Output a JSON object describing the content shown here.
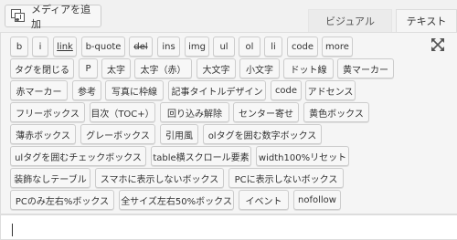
{
  "media_button": {
    "label": "メディアを追加",
    "icon": "media-icon"
  },
  "tabs": {
    "visual": "ビジュアル",
    "text": "テキスト"
  },
  "toolbar": {
    "fullscreen_icon": "fullscreen-icon",
    "rows": [
      [
        "b",
        "i",
        "link",
        "b-quote",
        "del",
        "ins",
        "img",
        "ul",
        "ol",
        "li",
        "code",
        "more"
      ],
      [
        "タグを閉じる",
        "P",
        "太字",
        "太字（赤）",
        "大文字",
        "小文字",
        "ドット線",
        "黄マーカー"
      ],
      [
        "赤マーカー",
        "参考",
        "写真に枠線",
        "記事タイトルデザイン",
        "code",
        "アドセンス"
      ],
      [
        "フリーボックス",
        "目次（TOC+）",
        "回り込み解除",
        "センター寄せ",
        "黄色ボックス"
      ],
      [
        "薄赤ボックス",
        "グレーボックス",
        "引用風",
        "olタグを囲む数字ボックス"
      ],
      [
        "ulタグを囲むチェックボックス",
        "table横スクロール要素",
        "width100%リセット"
      ],
      [
        "装飾なしテーブル",
        "スマホに表示しないボックス",
        "PCに表示しないボックス"
      ],
      [
        "PCのみ左右%ボックス",
        "全サイズ左右50%ボックス",
        "イベント",
        "nofollow"
      ]
    ]
  },
  "editor": {
    "content": ""
  }
}
